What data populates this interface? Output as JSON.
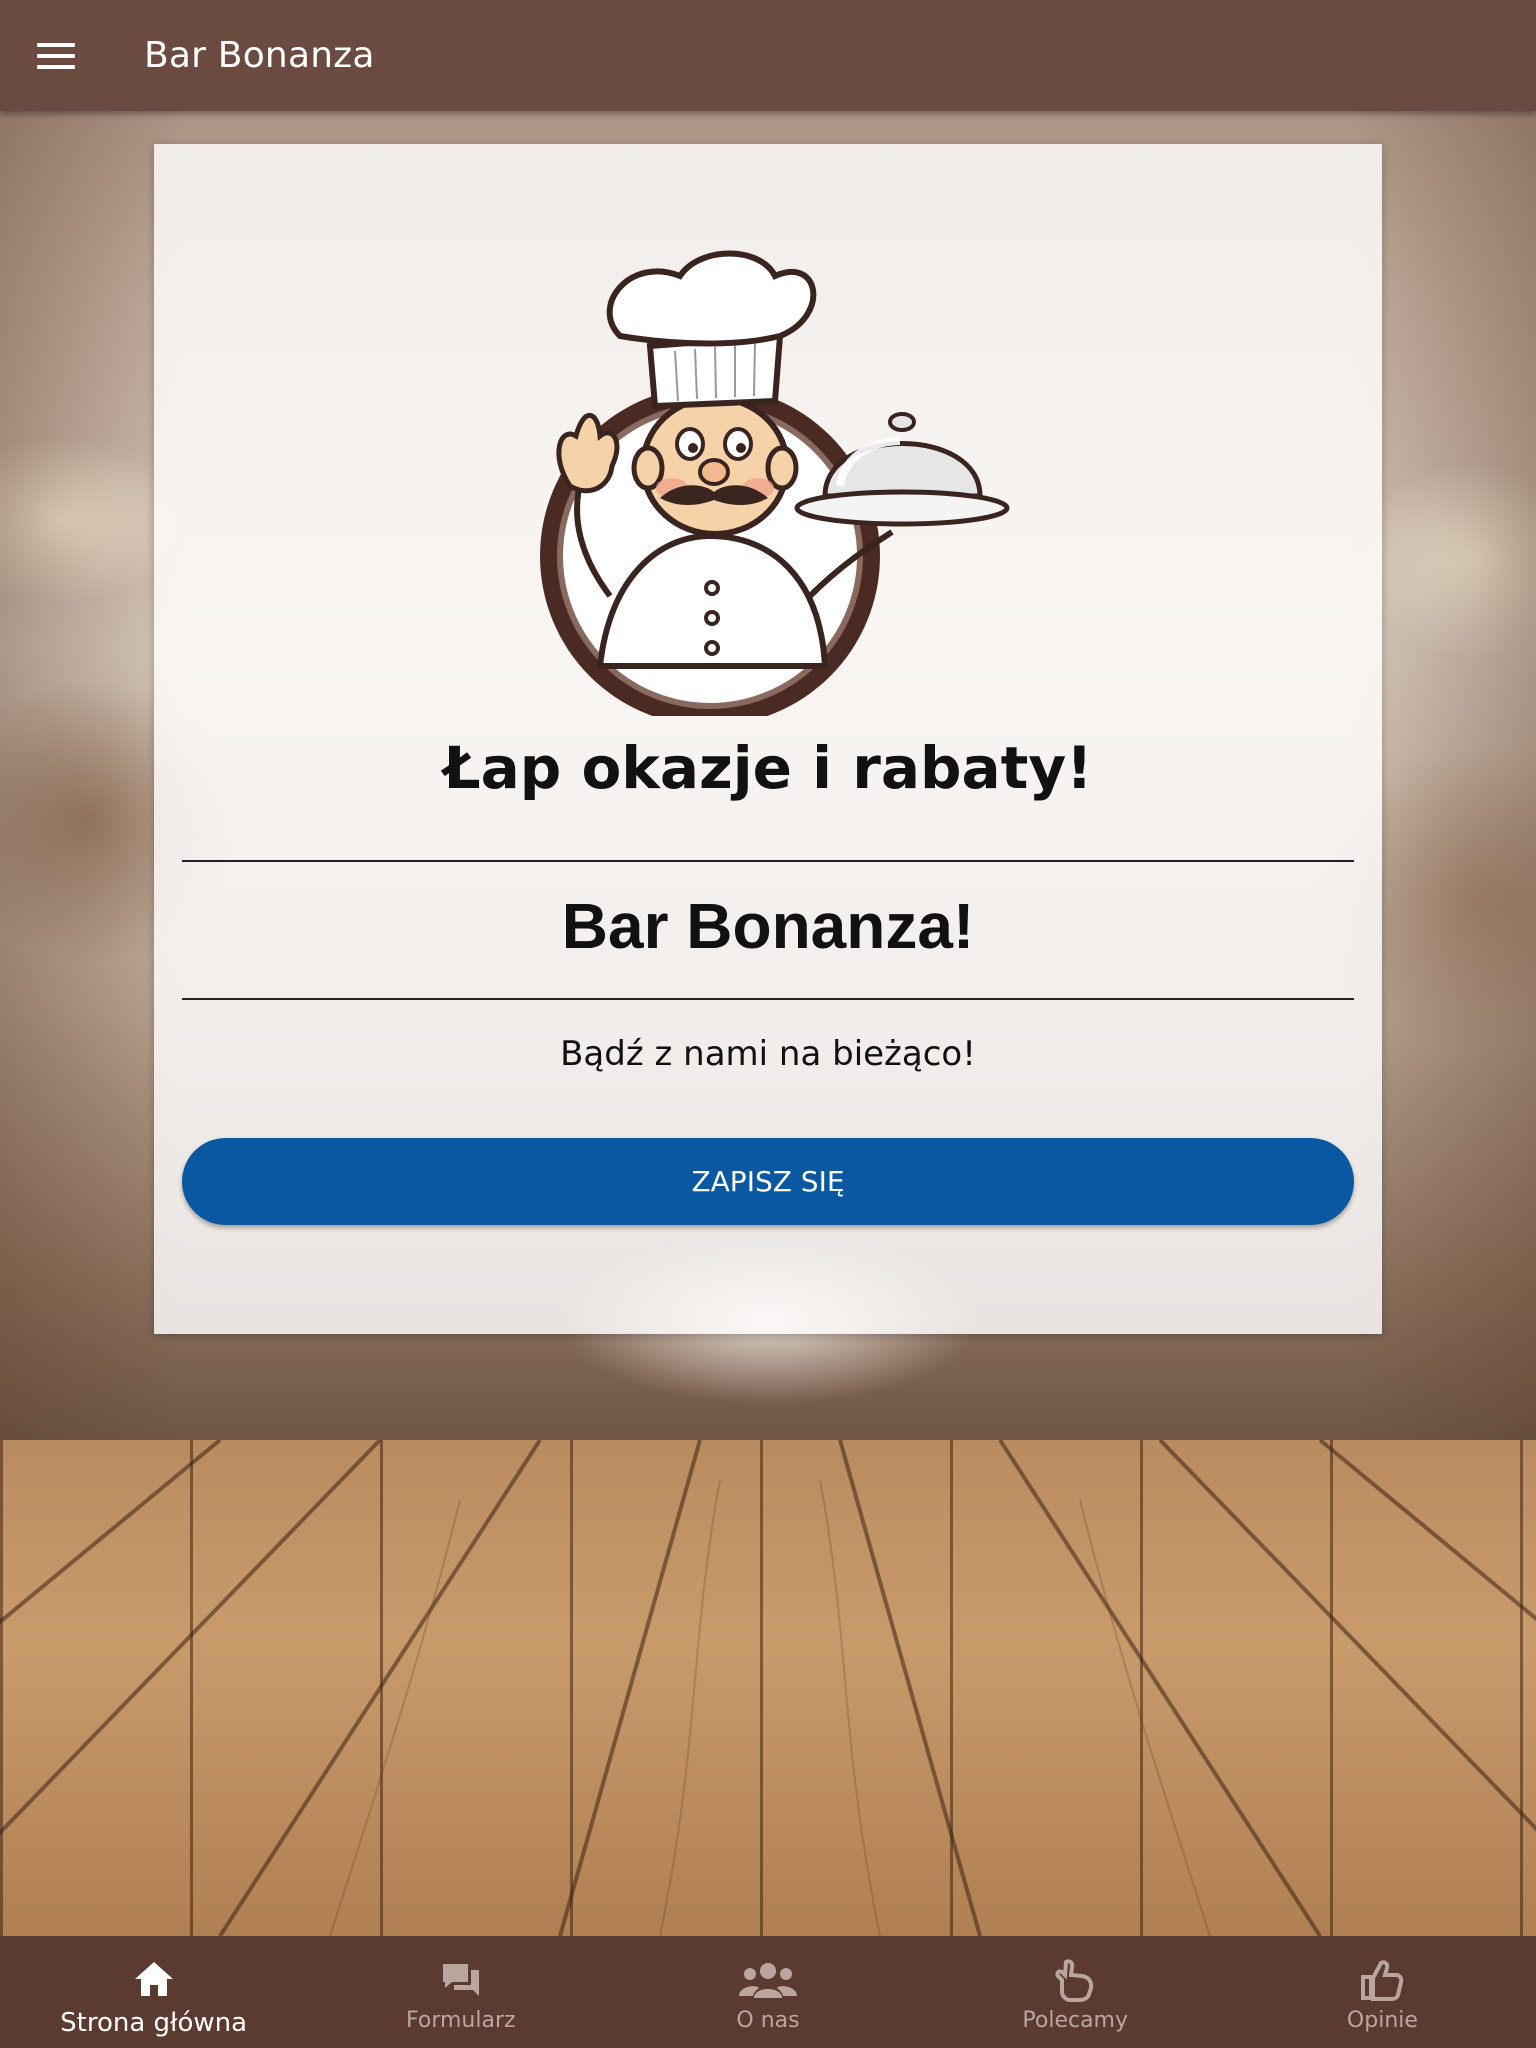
{
  "app": {
    "title": "Bar Bonanza"
  },
  "header": {
    "menu_icon": "hamburger-menu-icon"
  },
  "card": {
    "logo": "chef-mascot-logo",
    "heading": "Łap okazje i rabaty!",
    "bar_name": "Bar Bonanza!",
    "tagline": "Bądź z nami na bieżąco!",
    "subscribe_label": "ZAPISZ SIĘ"
  },
  "bottom_nav": {
    "items": [
      {
        "label": "Strona główna",
        "icon": "home-icon",
        "active": true
      },
      {
        "label": "Formularz",
        "icon": "chat-bubbles-icon",
        "active": false
      },
      {
        "label": "O nas",
        "icon": "people-icon",
        "active": false
      },
      {
        "label": "Polecamy",
        "icon": "pointing-hand-icon",
        "active": false
      },
      {
        "label": "Opinie",
        "icon": "thumbs-up-icon",
        "active": false
      }
    ]
  },
  "colors": {
    "top_bar": "#6b4a3f",
    "bottom_nav": "#5b3a30",
    "button": "#0a58a1",
    "nav_active": "#ffffff",
    "nav_inactive": "#b9a79f"
  }
}
